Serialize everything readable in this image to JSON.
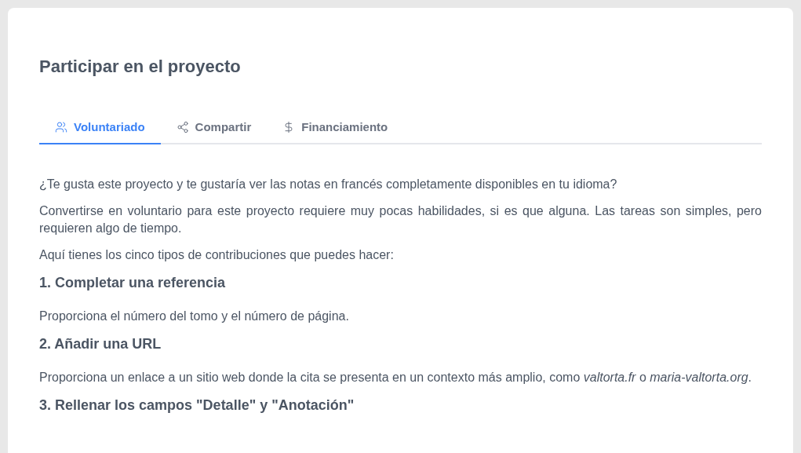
{
  "title": "Participar en el proyecto",
  "tabs": [
    {
      "label": "Voluntariado",
      "selected": true
    },
    {
      "label": "Compartir",
      "selected": false
    },
    {
      "label": "Financiamiento",
      "selected": false
    }
  ],
  "content": [
    {
      "kind": "paragraph",
      "text": "¿Te gusta este proyecto y te gustaría ver las notas en francés completamente disponibles en tu idioma?"
    },
    {
      "kind": "paragraph",
      "text": "Convertirse en voluntario para este proyecto requiere muy pocas habilidades, si es que alguna. Las tareas son simples, pero requieren algo de tiempo."
    },
    {
      "kind": "paragraph",
      "text": "Aquí tienes los cinco tipos de contribuciones que puedes hacer:"
    },
    {
      "kind": "heading",
      "text": "1. Completar una referencia"
    },
    {
      "kind": "paragraph",
      "text": "Proporciona el número del tomo y el número de página."
    },
    {
      "kind": "heading",
      "text": "2. Añadir una URL"
    },
    {
      "kind": "paragraph",
      "text": "Proporciona un enlace a un sitio web donde la cita se presenta en un contexto más amplio, como *valtorta.fr* o *maria-valtorta.org*."
    },
    {
      "kind": "heading",
      "text": "3. Rellenar los campos \"Detalle\" y \"Anotación\""
    }
  ]
}
